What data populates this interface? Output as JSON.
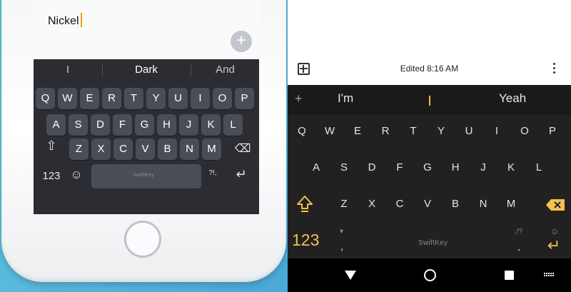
{
  "ios": {
    "note_text": "Nickel",
    "add_button": "+",
    "predictions": [
      "I",
      "Dark",
      "And"
    ],
    "rows": [
      [
        "Q",
        "W",
        "E",
        "R",
        "T",
        "Y",
        "U",
        "I",
        "O",
        "P"
      ],
      [
        "A",
        "S",
        "D",
        "F",
        "G",
        "H",
        "J",
        "K",
        "L"
      ],
      [
        "Z",
        "X",
        "C",
        "V",
        "B",
        "N",
        "M"
      ]
    ],
    "shift_icon": "⇧",
    "backspace_icon": "⌫",
    "numbers_label": "123",
    "emoji_icon": "☺",
    "punct_label": "?!,",
    "return_icon": "↵",
    "space_brand": "SwiftKey"
  },
  "android": {
    "toolbar": {
      "title": "Edited 8:16 AM"
    },
    "predictions": [
      "I'm",
      "Yeah"
    ],
    "pred_plus": "+",
    "rows": [
      [
        "Q",
        "W",
        "E",
        "R",
        "T",
        "Y",
        "U",
        "I",
        "O",
        "P"
      ],
      [
        "A",
        "S",
        "D",
        "F",
        "G",
        "H",
        "J",
        "K",
        "L"
      ],
      [
        "Z",
        "X",
        "C",
        "V",
        "B",
        "N",
        "M"
      ]
    ],
    "numbers_label": "123",
    "comma": ",",
    "period": ".",
    "punct_hint": ",!?",
    "emoji_hint": "☺",
    "return_icon": "↵",
    "space_brand": "SwiftKey",
    "accent_color": "#f2c14e"
  }
}
